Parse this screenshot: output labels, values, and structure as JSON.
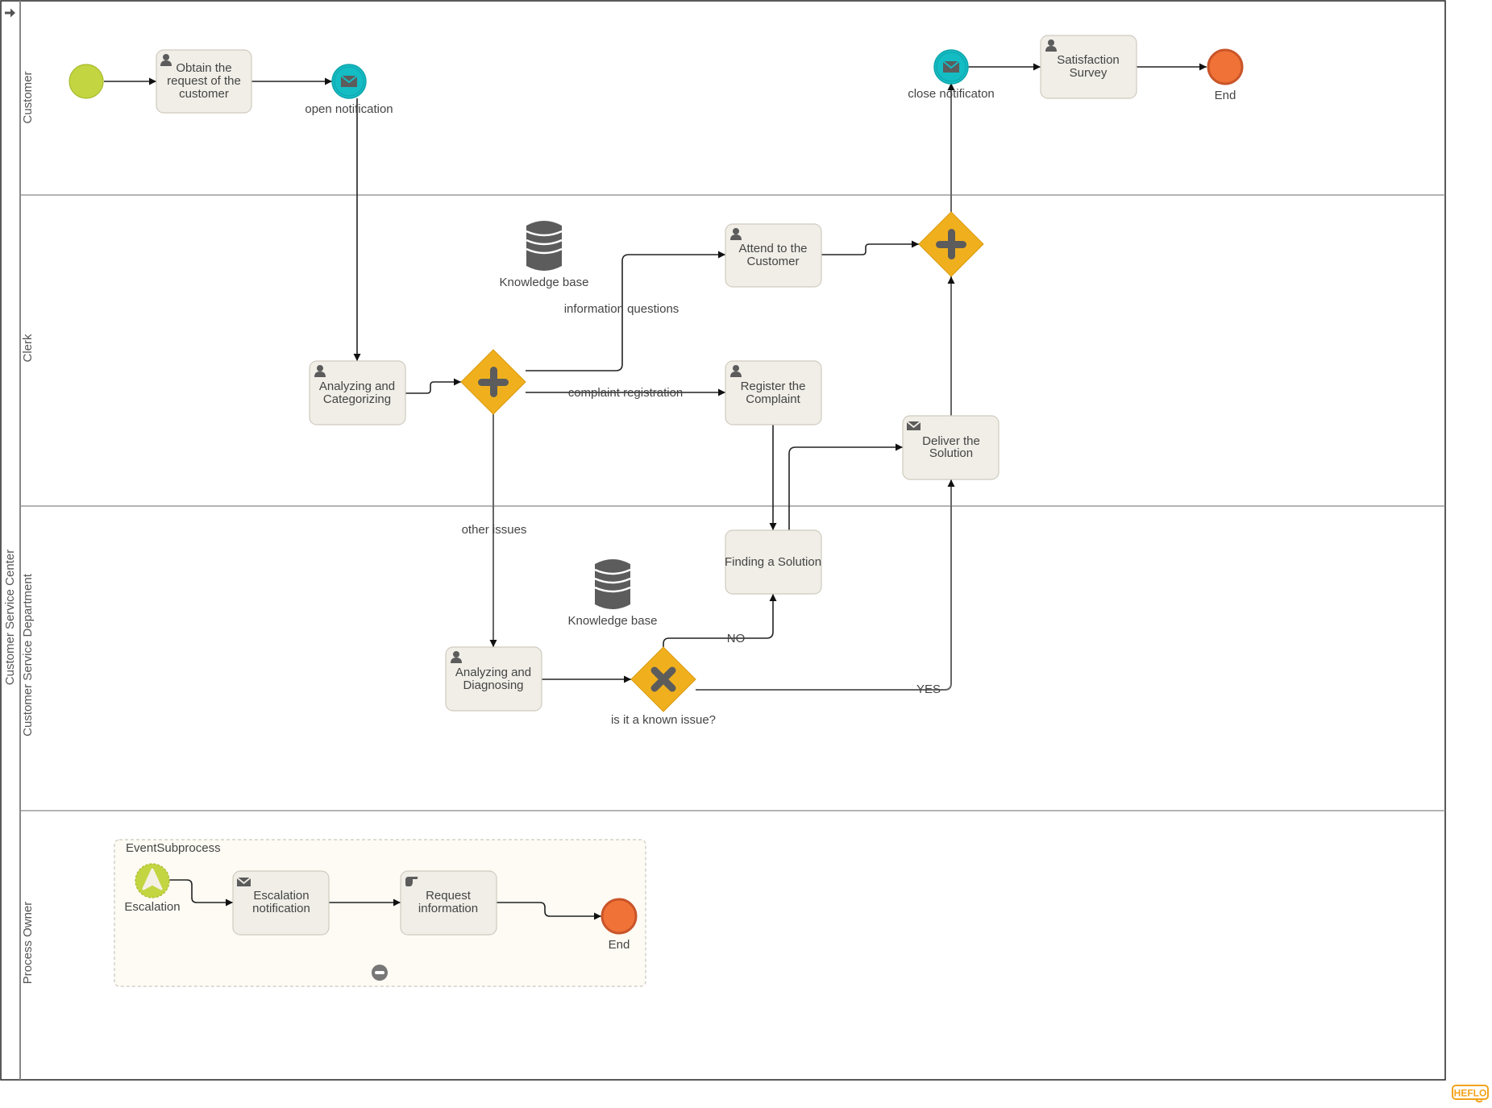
{
  "pool": {
    "name": "Customer Service Center"
  },
  "lanes": [
    {
      "name": "Customer"
    },
    {
      "name": "Clerk"
    },
    {
      "name": "Customer Service Department"
    },
    {
      "name": "Process Owner"
    }
  ],
  "nodes": {
    "start": {
      "type": "start-event",
      "label": ""
    },
    "obtain": {
      "type": "user-task",
      "label_lines": [
        "Obtain the",
        "request of the",
        "customer"
      ]
    },
    "open_notification": {
      "type": "message-event",
      "label": "open notification"
    },
    "close_notification": {
      "type": "message-event",
      "label": "close notificaton"
    },
    "satisfaction": {
      "type": "user-task",
      "label_lines": [
        "Satisfaction",
        "Survey"
      ]
    },
    "end_main": {
      "type": "end-event",
      "label": "End"
    },
    "kb1": {
      "type": "data-store",
      "label": "Knowledge base"
    },
    "attend": {
      "type": "user-task",
      "label_lines": [
        "Attend to the",
        "Customer"
      ]
    },
    "gw_split": {
      "type": "parallel-gateway",
      "label": ""
    },
    "gw_join": {
      "type": "parallel-gateway",
      "label": ""
    },
    "analyze_cat": {
      "type": "user-task",
      "label_lines": [
        "Analyzing and",
        "Categorizing"
      ]
    },
    "register": {
      "type": "user-task",
      "label_lines": [
        "Register the",
        "Complaint"
      ]
    },
    "deliver": {
      "type": "send-task",
      "label_lines": [
        "Deliver the",
        "Solution"
      ]
    },
    "finding": {
      "type": "task",
      "label_lines": [
        "Finding a Solution"
      ]
    },
    "kb2": {
      "type": "data-store",
      "label": "Knowledge base"
    },
    "analyze_diag": {
      "type": "user-task",
      "label_lines": [
        "Analyzing and",
        "Diagnosing"
      ]
    },
    "gw_known": {
      "type": "exclusive-gateway",
      "label": "is it a known issue?"
    }
  },
  "flow_labels": {
    "info_questions": "information questions",
    "complaint_registration": "complaint registration",
    "other_issues": "other issues",
    "no": "NO",
    "yes": "YES"
  },
  "subprocess": {
    "title": "EventSubprocess",
    "escalation": {
      "type": "escalation-start-event",
      "label": "Escalation"
    },
    "escalation_notification": {
      "type": "send-task",
      "label_lines": [
        "Escalation",
        "notification"
      ]
    },
    "request_information": {
      "type": "manual-task",
      "label_lines": [
        "Request",
        "information"
      ]
    },
    "end": {
      "type": "end-event",
      "label": "End"
    },
    "collapse_button": "collapse"
  },
  "toolbar": {
    "expand_icon": "arrow-right-icon"
  },
  "brand": {
    "logo_text": "HEFLO",
    "color": "#f3a31b"
  },
  "colors": {
    "start": "#c3d541",
    "message_event": "#14bcc4",
    "end": "#f07236",
    "gateway": "#f0b01e",
    "task_fill": "#f0eee7",
    "icon": "#5c5c5c"
  }
}
